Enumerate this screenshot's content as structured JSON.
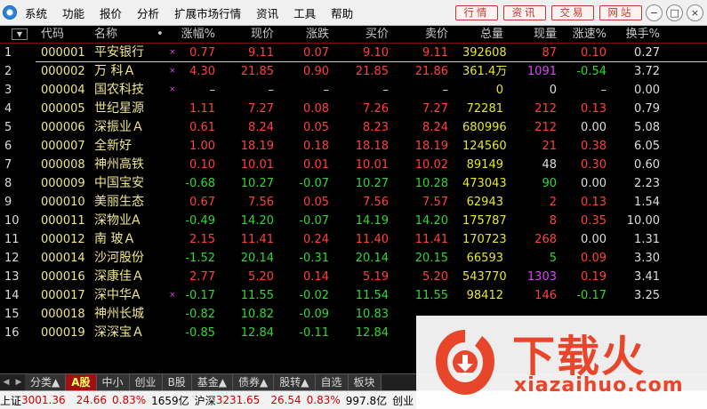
{
  "menu": [
    "系统",
    "功能",
    "报价",
    "分析",
    "扩展市场行情",
    "资讯",
    "工具",
    "帮助"
  ],
  "top_buttons": [
    "行情",
    "资讯",
    "交易",
    "网站"
  ],
  "window_controls": [
    "−",
    "□",
    "×"
  ],
  "headers": {
    "sort": "▼",
    "code": "代码",
    "name": "名称",
    "dot": "•",
    "change_pct": "涨幅%",
    "price": "现价",
    "change": "涨跌",
    "bid": "买价",
    "ask": "卖价",
    "volume": "总量",
    "cur_vol": "现量",
    "speed": "涨速%",
    "turnover": "换手%"
  },
  "rows": [
    {
      "idx": "1",
      "code": "000001",
      "name": "平安银行",
      "mark": "×",
      "change_pct": "0.77",
      "price": "9.11",
      "change": "0.07",
      "bid": "9.10",
      "ask": "9.11",
      "volume": "392608",
      "cur_vol": "87",
      "speed": "0.10",
      "turnover": "0.27",
      "color": "red",
      "cur_color": "red",
      "speed_color": "red"
    },
    {
      "idx": "2",
      "code": "000002",
      "name": "万 科Ａ",
      "mark": "×",
      "change_pct": "4.30",
      "price": "21.85",
      "change": "0.90",
      "bid": "21.85",
      "ask": "21.86",
      "volume": "361.4万",
      "cur_vol": "1091",
      "speed": "-0.54",
      "turnover": "3.72",
      "color": "red",
      "cur_color": "magenta",
      "speed_color": "green"
    },
    {
      "idx": "3",
      "code": "000004",
      "name": "国农科技",
      "mark": "×",
      "change_pct": "–",
      "price": "–",
      "change": "–",
      "bid": "–",
      "ask": "–",
      "volume": "0",
      "cur_vol": "0",
      "speed": "–",
      "turnover": "0.00",
      "color": "white",
      "cur_color": "white",
      "speed_color": "white"
    },
    {
      "idx": "4",
      "code": "000005",
      "name": "世纪星源",
      "mark": "",
      "change_pct": "1.11",
      "price": "7.27",
      "change": "0.08",
      "bid": "7.26",
      "ask": "7.27",
      "volume": "72281",
      "cur_vol": "212",
      "speed": "0.13",
      "turnover": "0.79",
      "color": "red",
      "cur_color": "red",
      "speed_color": "red"
    },
    {
      "idx": "5",
      "code": "000006",
      "name": "深振业Ａ",
      "mark": "",
      "change_pct": "0.61",
      "price": "8.24",
      "change": "0.05",
      "bid": "8.23",
      "ask": "8.24",
      "volume": "680996",
      "cur_vol": "212",
      "speed": "0.00",
      "turnover": "5.08",
      "color": "red",
      "cur_color": "red",
      "speed_color": "white"
    },
    {
      "idx": "6",
      "code": "000007",
      "name": "全新好",
      "mark": "",
      "change_pct": "1.00",
      "price": "18.19",
      "change": "0.18",
      "bid": "18.18",
      "ask": "18.19",
      "volume": "124560",
      "cur_vol": "21",
      "speed": "0.38",
      "turnover": "6.05",
      "color": "red",
      "cur_color": "red",
      "speed_color": "red"
    },
    {
      "idx": "7",
      "code": "000008",
      "name": "神州高铁",
      "mark": "",
      "change_pct": "0.10",
      "price": "10.01",
      "change": "0.01",
      "bid": "10.01",
      "ask": "10.02",
      "volume": "89149",
      "cur_vol": "48",
      "speed": "0.30",
      "turnover": "0.60",
      "color": "red",
      "cur_color": "white",
      "speed_color": "red"
    },
    {
      "idx": "8",
      "code": "000009",
      "name": "中国宝安",
      "mark": "",
      "change_pct": "-0.68",
      "price": "10.27",
      "change": "-0.07",
      "bid": "10.27",
      "ask": "10.28",
      "volume": "473043",
      "cur_vol": "90",
      "speed": "0.00",
      "turnover": "2.23",
      "color": "green",
      "cur_color": "green",
      "speed_color": "white"
    },
    {
      "idx": "9",
      "code": "000010",
      "name": "美丽生态",
      "mark": "",
      "change_pct": "0.67",
      "price": "7.56",
      "change": "0.05",
      "bid": "7.56",
      "ask": "7.57",
      "volume": "62943",
      "cur_vol": "2",
      "speed": "0.13",
      "turnover": "1.54",
      "color": "red",
      "cur_color": "red",
      "speed_color": "red"
    },
    {
      "idx": "10",
      "code": "000011",
      "name": "深物业A",
      "mark": "",
      "change_pct": "-0.49",
      "price": "14.20",
      "change": "-0.07",
      "bid": "14.19",
      "ask": "14.20",
      "volume": "175787",
      "cur_vol": "8",
      "speed": "0.35",
      "turnover": "10.00",
      "color": "green",
      "cur_color": "red",
      "speed_color": "red"
    },
    {
      "idx": "11",
      "code": "000012",
      "name": "南 玻Ａ",
      "mark": "",
      "change_pct": "2.15",
      "price": "11.41",
      "change": "0.24",
      "bid": "11.40",
      "ask": "11.41",
      "volume": "170723",
      "cur_vol": "268",
      "speed": "0.00",
      "turnover": "1.31",
      "color": "red",
      "cur_color": "red",
      "speed_color": "white"
    },
    {
      "idx": "12",
      "code": "000014",
      "name": "沙河股份",
      "mark": "",
      "change_pct": "-1.52",
      "price": "20.14",
      "change": "-0.31",
      "bid": "20.14",
      "ask": "20.15",
      "volume": "66593",
      "cur_vol": "5",
      "speed": "0.09",
      "turnover": "3.30",
      "color": "green",
      "cur_color": "green",
      "speed_color": "red"
    },
    {
      "idx": "13",
      "code": "000016",
      "name": "深康佳Ａ",
      "mark": "",
      "change_pct": "2.77",
      "price": "5.20",
      "change": "0.14",
      "bid": "5.19",
      "ask": "5.20",
      "volume": "543770",
      "cur_vol": "1303",
      "speed": "0.19",
      "turnover": "3.41",
      "color": "red",
      "cur_color": "magenta",
      "speed_color": "red"
    },
    {
      "idx": "14",
      "code": "000017",
      "name": "深中华A",
      "mark": "×",
      "change_pct": "-0.17",
      "price": "11.55",
      "change": "-0.02",
      "bid": "11.54",
      "ask": "11.55",
      "volume": "98412",
      "cur_vol": "146",
      "speed": "-0.17",
      "turnover": "3.25",
      "color": "green",
      "cur_color": "red",
      "speed_color": "green"
    },
    {
      "idx": "15",
      "code": "000018",
      "name": "神州长城",
      "mark": "",
      "change_pct": "-0.82",
      "price": "10.82",
      "change": "-0.09",
      "bid": "10.83",
      "ask": "",
      "volume": "",
      "cur_vol": "",
      "speed": "",
      "turnover": "",
      "color": "green",
      "cur_color": "green",
      "speed_color": "green"
    },
    {
      "idx": "16",
      "code": "000019",
      "name": "深深宝Ａ",
      "mark": "",
      "change_pct": "-0.85",
      "price": "12.84",
      "change": "-0.11",
      "bid": "12.84",
      "ask": "",
      "volume": "",
      "cur_vol": "",
      "speed": "",
      "turnover": "",
      "color": "green",
      "cur_color": "green",
      "speed_color": "green"
    }
  ],
  "tabs": [
    {
      "label": "分类▲",
      "active": false
    },
    {
      "label": "A股",
      "active": true
    },
    {
      "label": "中小",
      "active": false
    },
    {
      "label": "创业",
      "active": false
    },
    {
      "label": "B股",
      "active": false
    },
    {
      "label": "基金▲",
      "active": false
    },
    {
      "label": "债券▲",
      "active": false
    },
    {
      "label": "股转▲",
      "active": false
    },
    {
      "label": "自选",
      "active": false
    },
    {
      "label": "板块",
      "active": false
    }
  ],
  "status": {
    "sh_label": "上证",
    "sh_index": "3001.36",
    "sh_change": "24.66",
    "sh_pct": "0.83%",
    "sh_amount": "1659亿",
    "hs_label": "沪深",
    "hs_index": "3231.65",
    "hs_change": "26.54",
    "hs_pct": "0.83%",
    "hs_amount": "997.8亿",
    "cy_label": "创业"
  },
  "watermark": {
    "brand": "下载火",
    "domain": "xiazaihuo.com"
  }
}
